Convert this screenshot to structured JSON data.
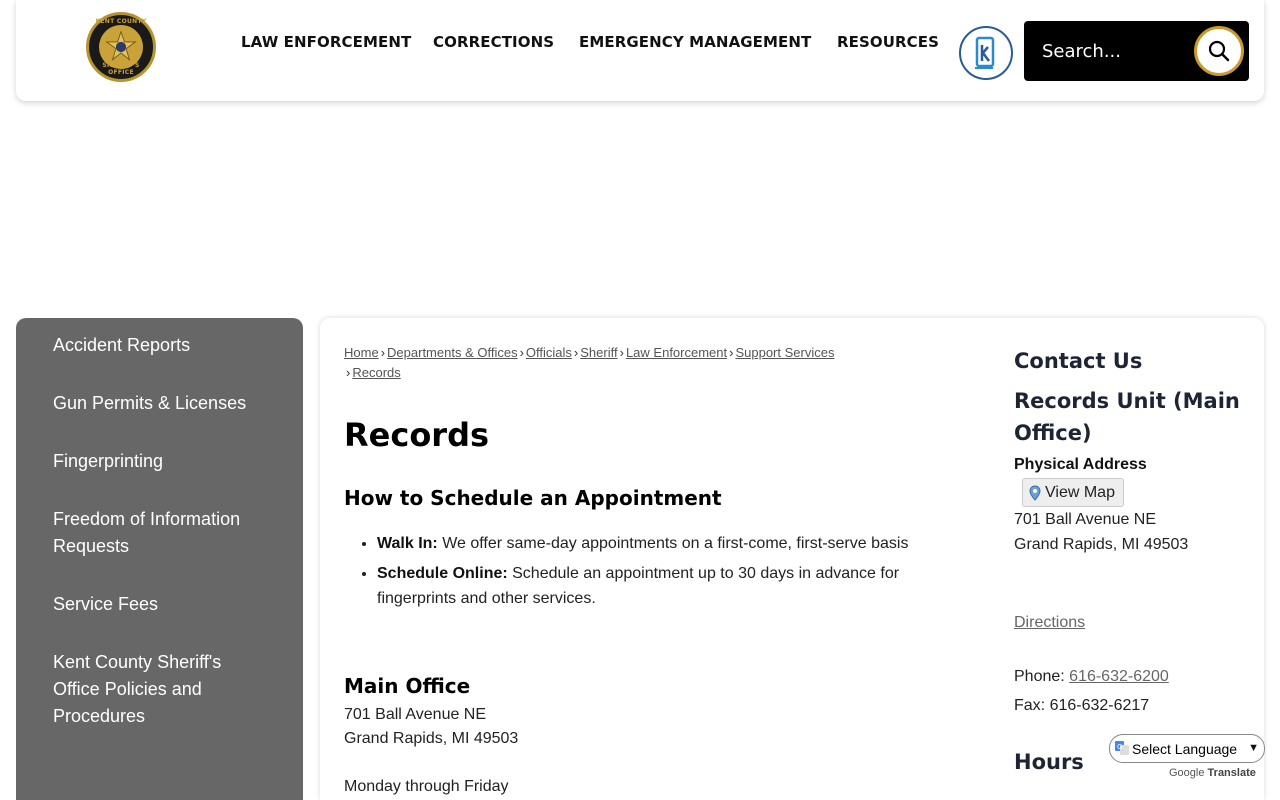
{
  "logo": {
    "top_text": "KENT COUNTY",
    "bottom_text": "SHERIFF'S OFFICE"
  },
  "nav": [
    "LAW ENFORCEMENT",
    "CORRECTIONS",
    "EMERGENCY MANAGEMENT",
    "RESOURCES"
  ],
  "search": {
    "placeholder": "Search..."
  },
  "sidebar": [
    "Accident Reports",
    "Gun Permits & Licenses",
    "Fingerprinting",
    "Freedom of Information Requests",
    "Service Fees",
    "Kent County Sheriff's Office Policies and Procedures"
  ],
  "breadcrumb": [
    "Home",
    "Departments & Offices",
    "Officials",
    "Sheriff",
    "Law Enforcement",
    "Support Services",
    "Records"
  ],
  "page_title": "Records",
  "schedule": {
    "heading": "How to Schedule an Appointment",
    "items": [
      {
        "label": "Walk In:",
        "text": " We offer same-day appointments on a first-come, first-serve basis"
      },
      {
        "label": "Schedule Online:",
        "text": " Schedule an appointment up to 30 days in advance for fingerprints and other services."
      }
    ]
  },
  "main_office": {
    "heading": "Main Office",
    "line1": "701 Ball Avenue NE",
    "line2": "Grand Rapids, MI 49503",
    "hours_line": "Monday through Friday"
  },
  "contact": {
    "heading": "Contact Us",
    "unit": "Records Unit (Main Office)",
    "address_label": "Physical Address",
    "view_map": "View Map",
    "address1": "701 Ball Avenue NE",
    "address2": "Grand Rapids, MI 49503",
    "directions": "Directions",
    "phone_label": "Phone: ",
    "phone": "616-632-6200",
    "fax": "Fax: 616-632-6217",
    "hours_heading": "Hours"
  },
  "translate": {
    "select_label": "Select Language",
    "powered_by": "Google",
    "translate": "Translate"
  },
  "colors": {
    "sidebar_bg": "#676767",
    "search_bg": "#000000",
    "accent_gold": "#c99a2e",
    "k_icon_blue": "#2a5a9a"
  }
}
